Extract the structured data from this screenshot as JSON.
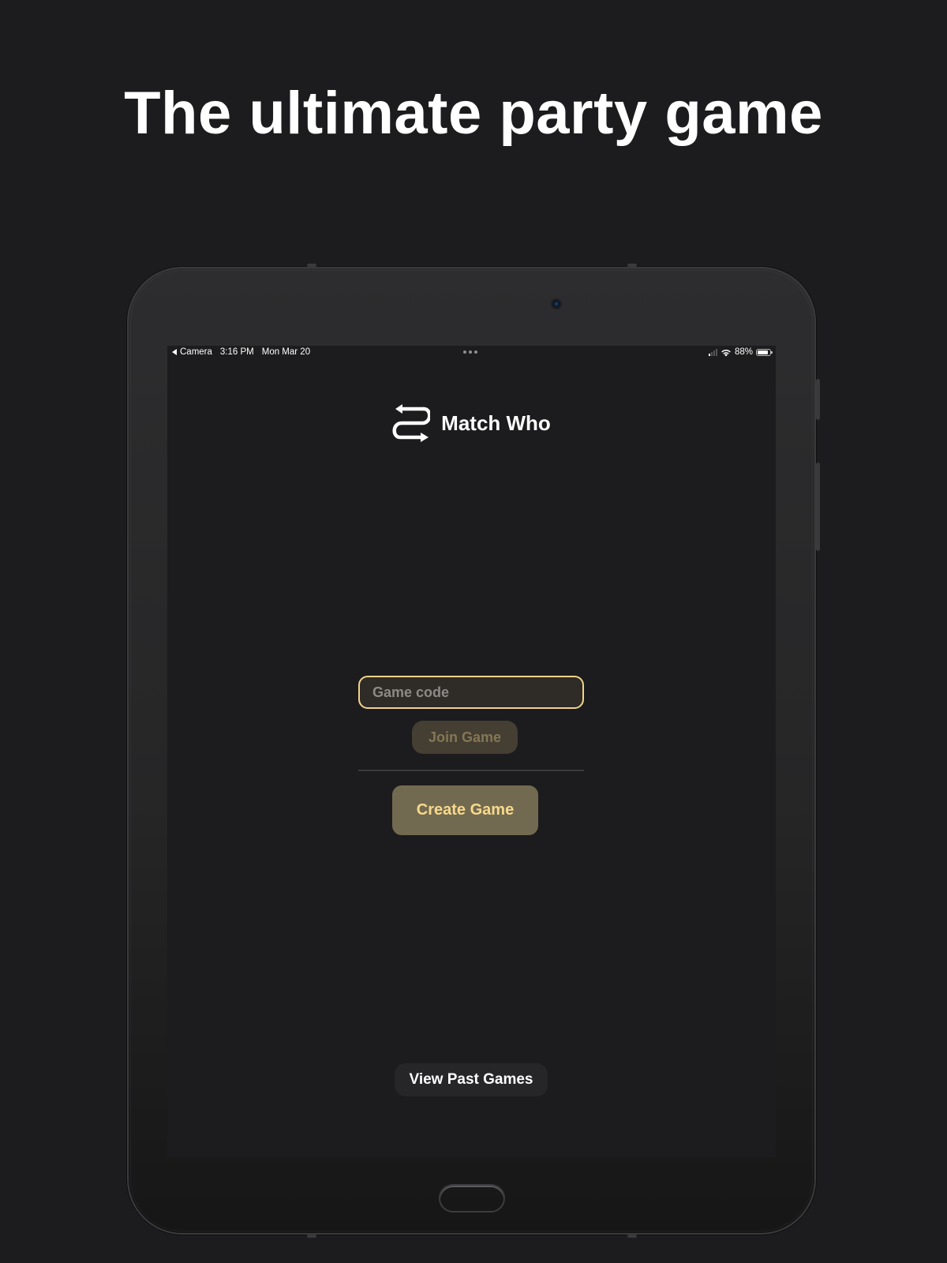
{
  "headline": "The ultimate party game",
  "status_bar": {
    "back_label": "Camera",
    "time": "3:16 PM",
    "date": "Mon Mar 20",
    "battery_percent": "88%",
    "battery_level": 0.88,
    "signal_bars_active": 1,
    "signal_bars_total": 4
  },
  "app": {
    "name": "Match Who",
    "logo_icon": "swap-arrows-icon"
  },
  "join": {
    "placeholder": "Game code",
    "value": "",
    "button_label": "Join Game"
  },
  "create": {
    "button_label": "Create Game"
  },
  "footer": {
    "past_games_label": "View Past Games"
  },
  "colors": {
    "background": "#1c1c1e",
    "accent": "#f2d488",
    "create_button_bg": "#726a50",
    "create_button_text": "#f7d98c",
    "join_button_bg": "#443e33",
    "join_button_text": "#857755"
  }
}
